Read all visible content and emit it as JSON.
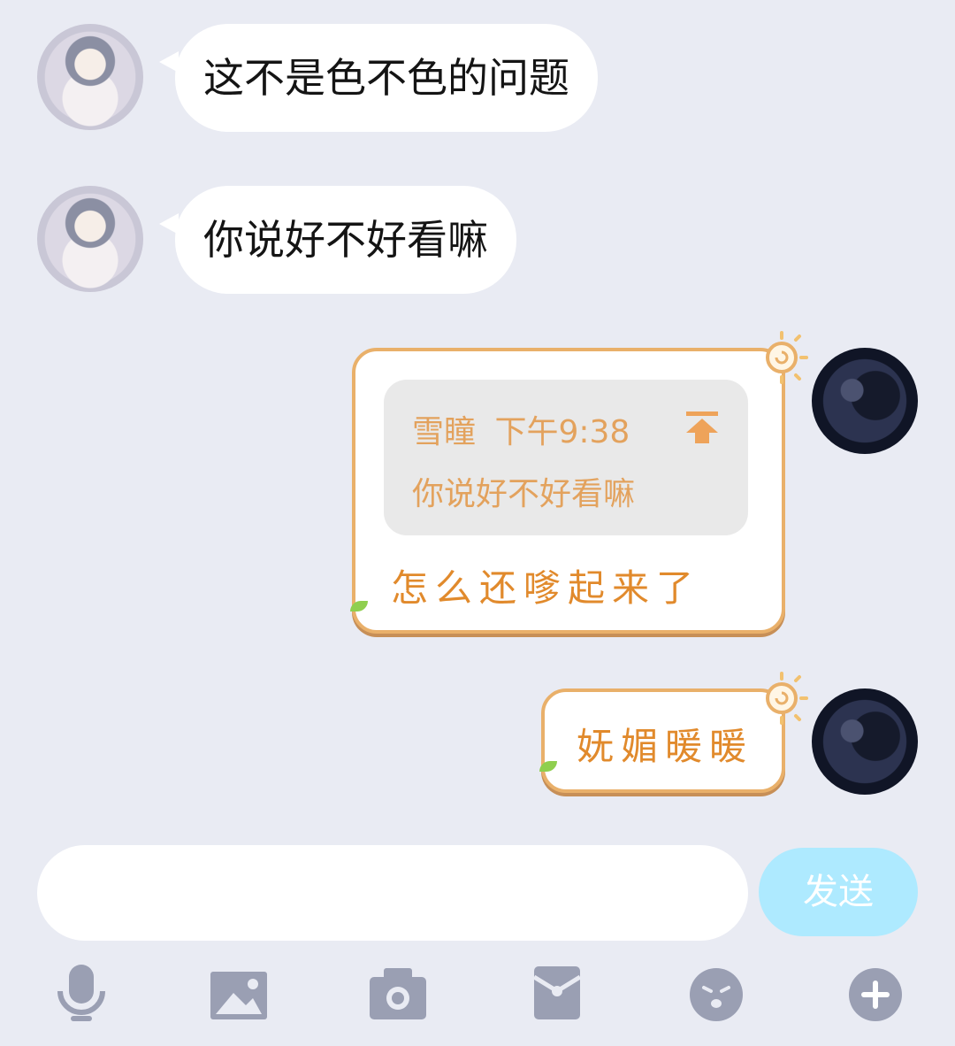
{
  "messages": [
    {
      "side": "left",
      "text": "这不是色不色的问题"
    },
    {
      "side": "left",
      "text": "你说好不好看嘛"
    },
    {
      "side": "right",
      "quote": {
        "sender": "雪瞳",
        "time": "下午9:38",
        "text": "你说好不好看嘛"
      },
      "text": "怎么还嗲起来了"
    },
    {
      "side": "right",
      "text": "妩媚暖暖"
    }
  ],
  "composer": {
    "input_value": "",
    "send_label": "发送"
  },
  "toolbar": {
    "icons": [
      "microphone-icon",
      "image-icon",
      "camera-icon",
      "red-packet-icon",
      "emoji-icon",
      "plus-icon"
    ]
  },
  "colors": {
    "background": "#e9ebf3",
    "theme_text": "#e18a2c",
    "theme_border": "#e9b06a",
    "send_button": "#aeeaff",
    "toolbar_icon": "#9a9fb3"
  }
}
